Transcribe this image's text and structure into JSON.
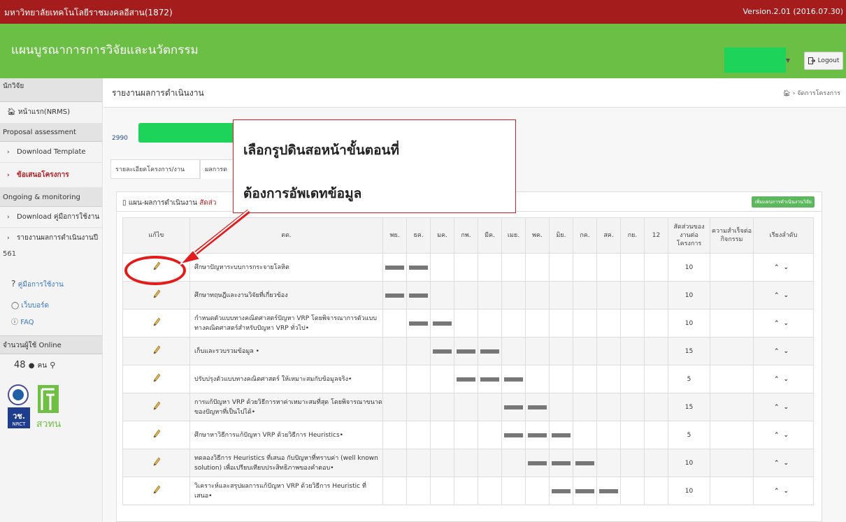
{
  "topbar": {
    "org": "มหาวิทยาลัยเทคโนโลยีราชมงคลอีสาน(1872)",
    "version": "Version.2.01 (2016.07.30)"
  },
  "header": {
    "app_title": "แผนบูรณาการการวิจัยและนวัตกรรม",
    "logout_label": "Logout"
  },
  "sidebar": {
    "section_researcher": "นักวิจัย",
    "home": "หน้าแรก(NRMS)",
    "section_proposal": "Proposal assessment",
    "download_template": "Download Template",
    "proposal": "ข้อเสนอโครงการ",
    "section_ongoing": "Ongoing & monitoring",
    "download_manual": "Download คู่มือการใช้งาน",
    "report_year": "รายงานผลการดำเนินงานปี",
    "report_year_cont": "561",
    "manual": "คู่มือการใช้งาน",
    "webboard": "เว็บบอร์ด",
    "faq": "FAQ",
    "online_heading": "จำนวนผู้ใช้ Online",
    "online_count": "48",
    "online_unit": "คน",
    "logo_text_1": "วช.",
    "logo_text_2": "NRCT",
    "logo_text_3": "สวทน"
  },
  "page": {
    "title": "รายงานผลการดำเนินงาน",
    "breadcrumb": "จัดการโครงการ",
    "project_id": "2990"
  },
  "tabs": [
    "รายละเอียดโครงการ/งาน",
    "ผลการด"
  ],
  "panel": {
    "title": "แผน-ผลการดำเนินงาน",
    "title_red": "สัดส่ว",
    "add_button": "เพิ่มแผนการดำเนินงานวิจัย"
  },
  "callout": {
    "line1": "เลือกรูปดินสอหน้าขั้นตอนที่",
    "line2": "ต้องการอัพเดทข้อมูล"
  },
  "table": {
    "headers": {
      "edit": "แก้ไข",
      "activity": "ตด.",
      "ratio": "สัดส่วนของงานต่อโครงการ",
      "success": "ความสำเร็จต่อกิจกรรม",
      "order": "เรียงลำดับ"
    },
    "months": [
      "พย.",
      "ธค.",
      "มค.",
      "กพ.",
      "มีค.",
      "เมย.",
      "พค.",
      "มิย.",
      "กค.",
      "สค.",
      "กย.",
      "12"
    ],
    "rows": [
      {
        "activity": "ศึกษาปัญหาระบบการกระจายโลหิต",
        "ratio": "10",
        "bars": [
          0,
          1
        ]
      },
      {
        "activity": "ศึกษาทฤษฎีและงานวิจัยที่เกี่ยวข้อง",
        "ratio": "10",
        "bars": [
          0,
          1
        ]
      },
      {
        "activity": "กำหนดตัวแบบทางคณิตศาสตร์ปัญหา VRP โดยพิจารณาการตัวแบบทางคณิตศาสตร์สำหรับปัญหา VRP ทั่วไป•",
        "ratio": "10",
        "bars": [
          1,
          2
        ]
      },
      {
        "activity": "เก็บและรวบรวมข้อมูล •",
        "ratio": "15",
        "bars": [
          2,
          3,
          4
        ]
      },
      {
        "activity": "ปรับปรุงตัวแบบทางคณิตศาสตร์ ให้เหมาะสมกับข้อมูลจริง•",
        "ratio": "5",
        "bars": [
          3,
          4,
          5
        ]
      },
      {
        "activity": "การแก้ปัญหา VRP ด้วยวิธีการหาค่าเหมาะสมที่สุด โดยพิจารณาขนาดของปัญหาที่เป็นไปได้•",
        "ratio": "15",
        "bars": [
          5,
          6
        ]
      },
      {
        "activity": "ศึกษาหาวิธีการแก้ปัญหา VRP ด้วยวิธีการ Heuristics•",
        "ratio": "5",
        "bars": [
          5,
          6,
          7
        ]
      },
      {
        "activity": "ทดลองวิธีการ Heuristics ที่เสนอ กับปัญหาที่ทราบค่า (well known solution) เพื่อเปรียบเทียบประสิทธิภาพของคำตอบ•",
        "ratio": "10",
        "bars": [
          6,
          7,
          8
        ]
      },
      {
        "activity": "วิเคราะห์และสรุปผลการแก้ปัญหา VRP ด้วยวิธีการ Heuristic ที่เสนอ•",
        "ratio": "10",
        "bars": [
          7,
          8,
          9
        ]
      }
    ]
  },
  "colors": {
    "topbar": "#a51c1c",
    "header": "#6cbf45",
    "accent_red": "#e41b1b"
  }
}
